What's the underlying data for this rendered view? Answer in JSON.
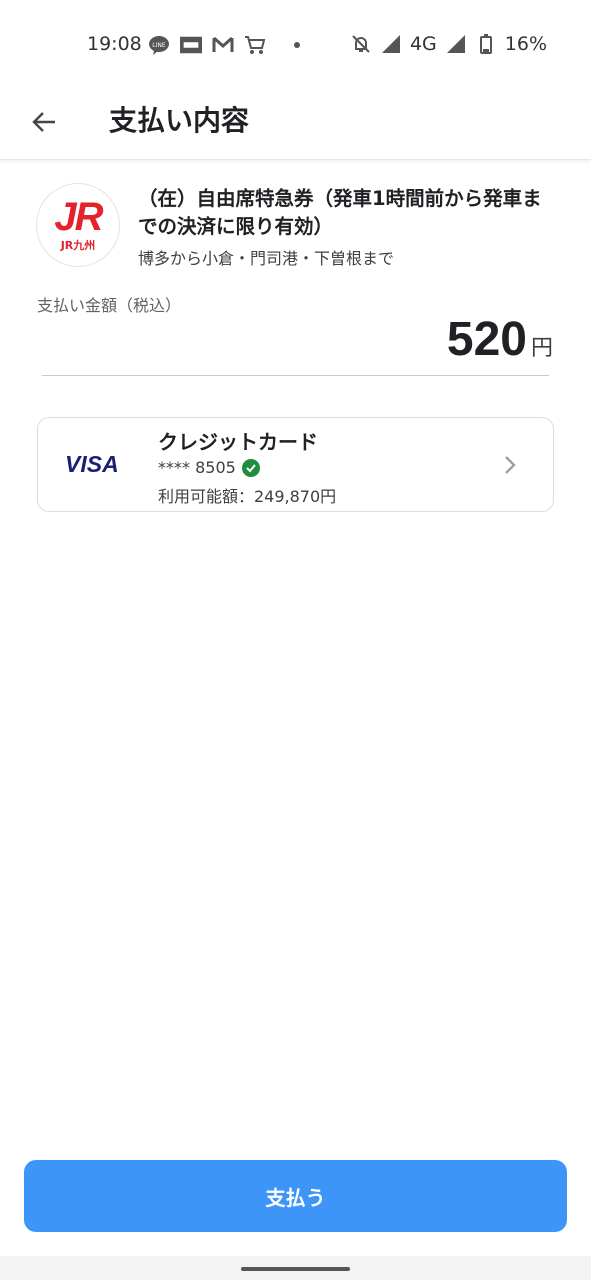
{
  "status_bar": {
    "time": "19:08",
    "network": "4G",
    "battery": "16%",
    "icons": [
      "line-icon",
      "notification-app-icon",
      "gmail-icon",
      "shopping-cart-icon",
      "dot-icon",
      "silent-bell-icon",
      "signal-icon",
      "battery-icon"
    ]
  },
  "app_bar": {
    "title": "支払い内容",
    "back_icon": "arrow-back-icon"
  },
  "merchant": {
    "logo_text": "JR",
    "logo_subtext": "JR九州",
    "product_name": "（在）自由席特急券（発車1時間前から発車までの決済に限り有効）",
    "route": "博多から小倉・門司港・下曽根まで"
  },
  "amount": {
    "label": "支払い金額（税込）",
    "value": "520",
    "unit": "円"
  },
  "payment_method": {
    "brand": "VISA",
    "title": "クレジットカード",
    "card_number": "**** 8505",
    "limit": "利用可能額：249,870円",
    "verified_icon": "check-circle-icon",
    "chevron_icon": "chevron-right-icon"
  },
  "pay_button": {
    "label": "支払う"
  },
  "colors": {
    "primary": "#3d95f7",
    "jr_red": "#e4222b",
    "visa_blue": "#1a1f71",
    "verified_green": "#1e8e3e"
  }
}
